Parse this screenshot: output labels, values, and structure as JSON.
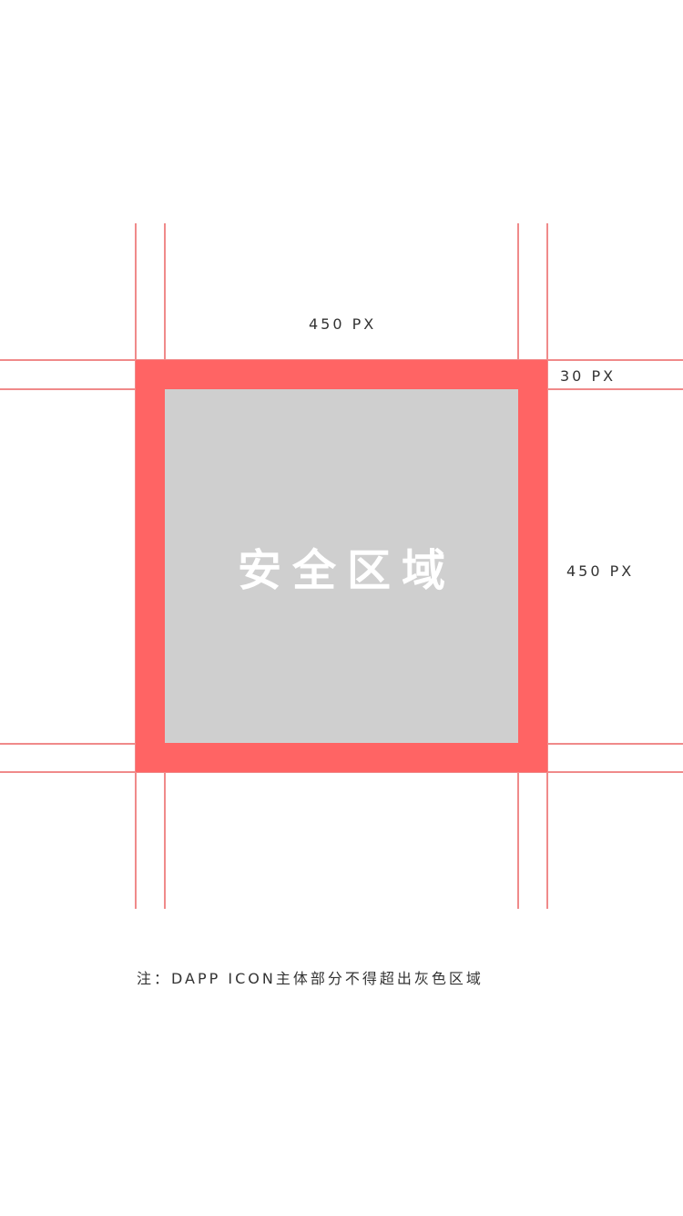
{
  "dimensions": {
    "width_label": "450 PX",
    "padding_label": "30 PX",
    "height_label": "450 PX"
  },
  "safe_area": {
    "label": "安全区域"
  },
  "note": {
    "text": "注：DAPP ICON主体部分不得超出灰色区域"
  },
  "colors": {
    "outer": "#ff6464",
    "safe": "#cfcfcf",
    "guide": "#f08a8a"
  }
}
